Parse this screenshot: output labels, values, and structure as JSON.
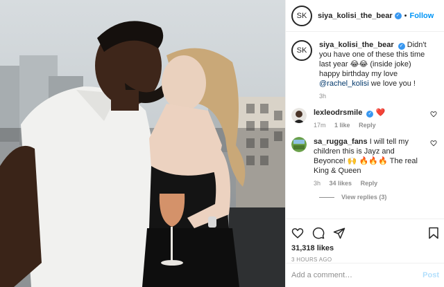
{
  "post": {
    "username": "siya_kolisi_the_bear",
    "avatar_monogram": "SK",
    "follow_label": "Follow",
    "separator": "•"
  },
  "caption": {
    "username": "siya_kolisi_the_bear",
    "text_before": "Didn't you have one of these this time last year 😂😂 (inside joke) happy birthday my love ",
    "mention": "@rachel_kolisi",
    "text_after": " we love you !",
    "age": "3h"
  },
  "comments": [
    {
      "username": "lexleodrsmile",
      "text": "❤️",
      "age": "17m",
      "likes": "1 like",
      "reply_label": "Reply"
    },
    {
      "username": "sa_rugga_fans",
      "text": "I will tell my children this is Jayz and Beyonce! 🙌 🔥🔥🔥 The real King & Queen",
      "age": "3h",
      "likes": "34 likes",
      "reply_label": "Reply",
      "view_replies": "View replies (3)"
    }
  ],
  "stats": {
    "likes": "31,318 likes",
    "posted": "3 HOURS AGO"
  },
  "comment_box": {
    "placeholder": "Add a comment…",
    "post_label": "Post"
  },
  "colors": {
    "accent": "#0095f6",
    "verified": "#3897f0",
    "muted": "#8e8e8e",
    "heart": "#ed4956"
  },
  "icons": [
    "verified-badge-icon",
    "heart-icon",
    "comment-icon",
    "share-icon",
    "bookmark-icon"
  ]
}
